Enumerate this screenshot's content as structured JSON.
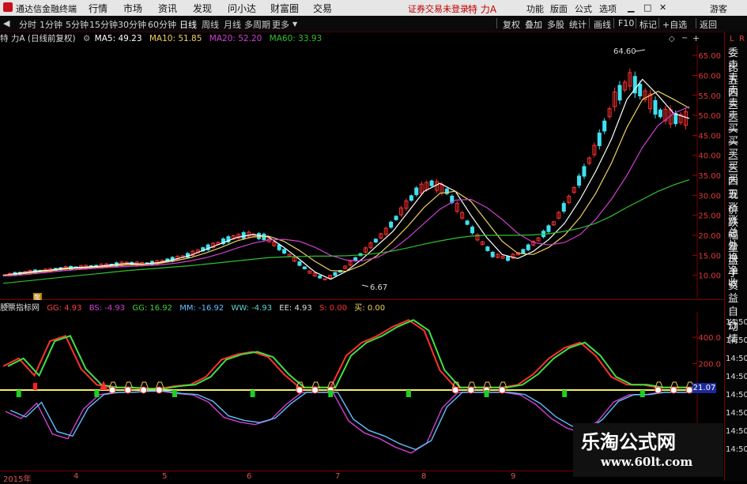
{
  "app": {
    "title": "通达信金融终端",
    "menu": [
      "行情",
      "市场",
      "资讯",
      "发现",
      "问小达",
      "财富圈",
      "交易"
    ],
    "notice": "证券交易未登录",
    "stock_name": "特 力A",
    "right_menu": [
      "功能",
      "版面",
      "公式",
      "选项"
    ],
    "user": "游客"
  },
  "periods": [
    "分时",
    "1分钟",
    "5分钟",
    "15分钟",
    "30分钟",
    "60分钟",
    "日线",
    "周线",
    "月线",
    "多周期",
    "更多"
  ],
  "active_period": "日线",
  "tools": [
    "复权",
    "叠加",
    "多股",
    "统计",
    "画线",
    "F10",
    "标记",
    "+自选",
    "返回"
  ],
  "main_info": {
    "name": "特 力A (日线前复权)",
    "ma5": "MA5: 49.23",
    "ma10": "MA10: 51.85",
    "ma20": "MA20: 52.20",
    "ma60": "MA60: 33.93",
    "colors": {
      "ma5": "#ffffff",
      "ma10": "#f0d060",
      "ma20": "#d040d0",
      "ma60": "#30c030"
    }
  },
  "annotations": {
    "high": "64.60",
    "low": "6.67",
    "marker": "龍"
  },
  "sub_info": {
    "name": "股票指标网",
    "gg": "GG: 4.93",
    "bs": "BS: -4.93",
    "gg2": "GG: 16.92",
    "mm": "MM: -16.92",
    "ww": "WW: -4.93",
    "ee": "EE: 4.93",
    "s": "S: 0.00",
    "buy": "买: 0.00"
  },
  "sidebar": [
    "委比",
    "卖五",
    "卖四",
    "卖三",
    "卖二",
    "卖一",
    "买一",
    "买二",
    "买三",
    "买四",
    "买五",
    "现价",
    "涨跌",
    "涨幅",
    "总量",
    "外盘",
    "换手",
    "净资",
    "收益",
    "自动",
    "行情"
  ],
  "sidebar_corner": "L",
  "sidebar_corner2": "R",
  "sub_times": [
    "14:50",
    "14:50",
    "14:50",
    "14:50",
    "14:50",
    "14:50",
    "14:50",
    "14:50"
  ],
  "current_value": "21.07",
  "chart_data": [
    {
      "type": "candlestick",
      "title": "特 力A (日线前复权)",
      "y_ticks": [
        "65.00",
        "60.00",
        "55.00",
        "50.00",
        "45.00",
        "40.00",
        "35.00",
        "30.00",
        "25.00",
        "20.00",
        "15.00",
        "10.00"
      ],
      "ylim": [
        5,
        67
      ],
      "x_ticks": [
        "2015年",
        "4",
        "5",
        "6",
        "7",
        "8",
        "9"
      ],
      "series": [
        {
          "name": "MA5",
          "values": [
            10,
            10.5,
            11,
            11.3,
            11.8,
            12,
            12.2,
            12.6,
            13,
            12.8,
            13.2,
            14,
            15,
            16.5,
            18,
            19.5,
            20.2,
            19.6,
            17,
            14,
            10.8,
            9,
            11,
            14,
            17.5,
            21,
            26,
            31,
            33,
            31,
            25,
            19.5,
            15.2,
            14.2,
            16,
            19,
            23,
            29,
            36,
            44,
            54,
            59,
            55,
            50.5,
            49.2
          ]
        },
        {
          "name": "MA10",
          "values": [
            10,
            10.3,
            10.7,
            11.1,
            11.6,
            11.8,
            12,
            12.3,
            12.6,
            12.7,
            13,
            13.6,
            14.4,
            15.6,
            17,
            18.6,
            19.6,
            19.8,
            18.5,
            16.2,
            13.5,
            11.2,
            11,
            12.5,
            15,
            18.5,
            22.5,
            27,
            30.5,
            31,
            28.5,
            23.5,
            18.5,
            15.5,
            15.2,
            17,
            20,
            24.5,
            30.5,
            38,
            47,
            54,
            56,
            54,
            51.8
          ]
        },
        {
          "name": "MA20",
          "values": [
            9.8,
            10,
            10.4,
            10.8,
            11.2,
            11.5,
            11.8,
            12,
            12.2,
            12.4,
            12.6,
            13,
            13.6,
            14.4,
            15.5,
            16.8,
            18,
            18.8,
            19,
            18.5,
            17,
            15,
            13.8,
            13.6,
            14.5,
            16.5,
            19.5,
            23,
            26.5,
            28.8,
            29,
            27,
            24,
            20.5,
            18.2,
            17.6,
            18.2,
            20.2,
            24,
            29,
            35,
            42,
            47.5,
            50.5,
            52.2
          ]
        },
        {
          "name": "MA60",
          "values": [
            8,
            8.4,
            8.8,
            9.2,
            9.6,
            10,
            10.4,
            10.8,
            11.2,
            11.5,
            11.8,
            12.1,
            12.4,
            12.8,
            13.2,
            13.6,
            14,
            14.4,
            14.6,
            14.7,
            14.8,
            14.8,
            14.9,
            15.1,
            15.5,
            16.1,
            16.9,
            17.8,
            18.6,
            19.3,
            19.8,
            20,
            20,
            20,
            20.1,
            20.4,
            21,
            21.8,
            23,
            24.8,
            27,
            29,
            31,
            32.6,
            33.9
          ]
        }
      ]
    },
    {
      "type": "line",
      "title": "股票指标网",
      "y_ticks": [
        "400.0",
        "200.0"
      ],
      "ylim": [
        -550,
        550
      ],
      "series": [
        {
          "name": "GG",
          "values": [
            180,
            240,
            110,
            370,
            410,
            160,
            40,
            20,
            20,
            10,
            10,
            30,
            40,
            100,
            230,
            270,
            290,
            250,
            120,
            20,
            20,
            20,
            260,
            360,
            410,
            480,
            530,
            450,
            150,
            20,
            20,
            20,
            20,
            40,
            120,
            240,
            320,
            360,
            260,
            100,
            40,
            40,
            20,
            20,
            20
          ]
        },
        {
          "name": "BS",
          "values": [
            -180,
            -240,
            -110,
            -370,
            -410,
            -160,
            -40,
            -20,
            -20,
            -10,
            -10,
            -30,
            -40,
            -100,
            -230,
            -270,
            -290,
            -250,
            -120,
            -20,
            -20,
            -20,
            -260,
            -360,
            -410,
            -480,
            -530,
            -450,
            -150,
            -20,
            -20,
            -20,
            -20,
            -40,
            -120,
            -240,
            -320,
            -360,
            -260,
            -100,
            -40,
            -40,
            -20,
            -20,
            -20
          ]
        }
      ]
    }
  ]
}
